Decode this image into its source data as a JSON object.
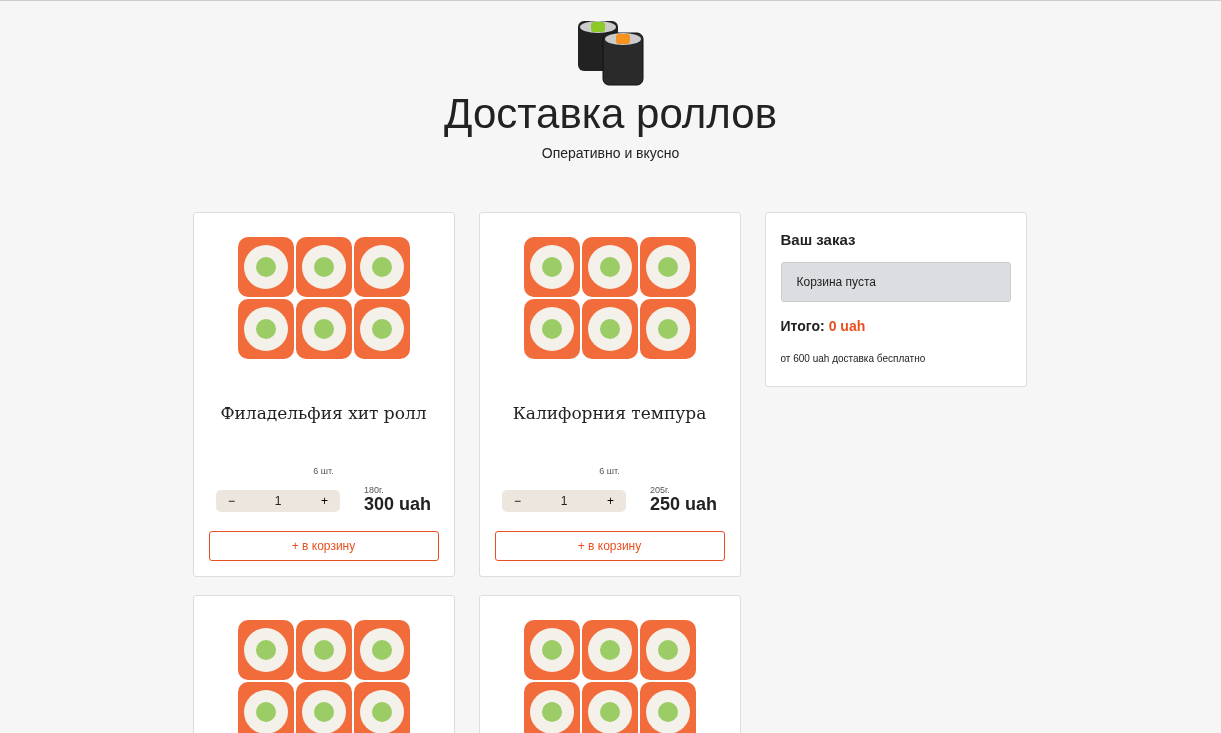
{
  "header": {
    "title": "Доставка роллов",
    "subtitle": "Оперативно и вкусно"
  },
  "products": [
    {
      "kind": "full",
      "title": "Филадельфия хит ролл",
      "pieces": "6 шт.",
      "count": "1",
      "minus": "−",
      "plus": "+",
      "weight": "180г.",
      "price": "300 uah",
      "button": "+ в корзину"
    },
    {
      "kind": "full",
      "title": "Калифорния темпура",
      "pieces": "6 шт.",
      "count": "1",
      "minus": "−",
      "plus": "+",
      "weight": "205г.",
      "price": "250 uah",
      "button": "+ в корзину"
    },
    {
      "kind": "photo"
    },
    {
      "kind": "photo"
    }
  ],
  "cart": {
    "title": "Ваш заказ",
    "empty": "Корзина пуста",
    "total_label": "Итого:",
    "total": "0 uah",
    "note": "от 600 uah доставка бесплатно"
  }
}
